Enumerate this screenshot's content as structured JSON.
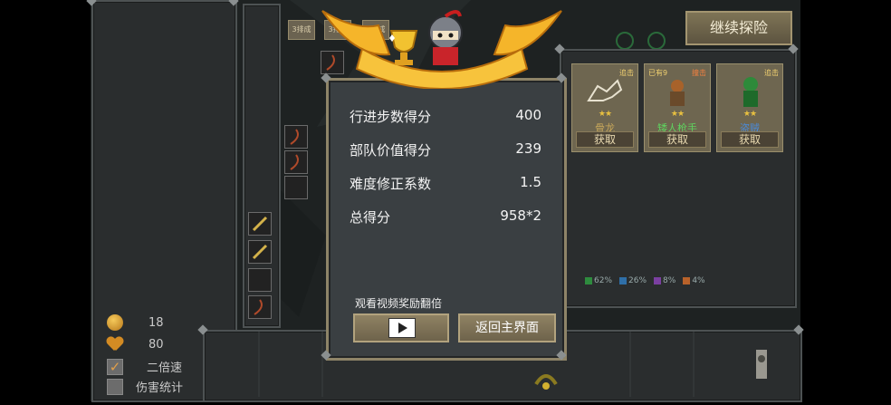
{
  "left_panel": {
    "gold_value": "18",
    "health_value": "80",
    "double_speed_label": "二倍速",
    "double_speed_checked": true,
    "damage_stats_label": "伤害统计",
    "damage_stats_checked": false
  },
  "tabs": [
    "3排成",
    "3排成",
    "3排成"
  ],
  "continue_button": "继续探险",
  "unit_cards": [
    {
      "tag_left": "",
      "tag_right": "追击",
      "name": "骨龙",
      "name_color": "#c9a85a",
      "stars": "★★",
      "button": "获取"
    },
    {
      "tag_left": "已有9",
      "tag_right": "撞击",
      "name": "矮人枪手",
      "name_color": "#5fd35f",
      "stars": "★★",
      "button": "获取"
    },
    {
      "tag_left": "",
      "tag_right": "追击",
      "name": "盗贼",
      "name_color": "#4a8ad8",
      "stars": "★★",
      "button": "获取"
    }
  ],
  "legend": [
    {
      "label": "62%",
      "color": "#2e8b3e"
    },
    {
      "label": "26%",
      "color": "#2f6fa8"
    },
    {
      "label": "8%",
      "color": "#7a3fa0"
    },
    {
      "label": "4%",
      "color": "#b8622a"
    }
  ],
  "score_dialog": {
    "rows": [
      {
        "label": "行进步数得分",
        "value": "400"
      },
      {
        "label": "部队价值得分",
        "value": "239"
      },
      {
        "label": "难度修正系数",
        "value": "1.5"
      },
      {
        "label": "总得分",
        "value": "958*2"
      }
    ],
    "watch_video_label": "观看视频奖励翻倍",
    "return_button": "返回主界面"
  },
  "icons": [
    "trophy-icon",
    "ninja-mascot-icon",
    "play-icon",
    "coin-icon",
    "heart-icon",
    "checkbox-icon",
    "sword-icon",
    "bone-dragon-icon",
    "dwarf-gunner-icon",
    "rogue-icon",
    "totem-icon",
    "scorpion-icon"
  ]
}
